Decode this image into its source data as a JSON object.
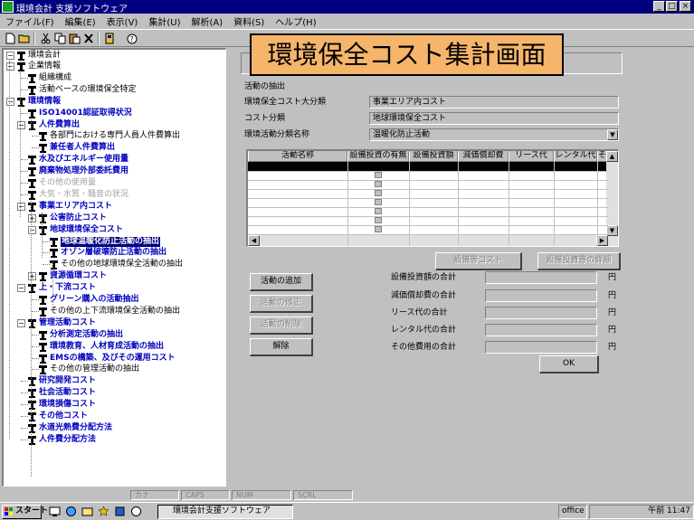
{
  "window": {
    "title": "環境会計 支援ソフトウェア",
    "minimize": "_",
    "maximize": "□",
    "close": "×"
  },
  "menu": [
    "ファイル(F)",
    "編集(E)",
    "表示(V)",
    "集計(U)",
    "解析(A)",
    "資料(S)",
    "ヘルプ(H)"
  ],
  "banner": "環境保全コスト集計画面",
  "tree": {
    "root": "環境会計",
    "items": [
      {
        "text": "企業情報",
        "style": "black"
      },
      {
        "text": "組織構成",
        "style": "black"
      },
      {
        "text": "活動ベースの環境保全特定",
        "style": "black"
      },
      {
        "text": "環境情報",
        "style": "blue"
      },
      {
        "text": "ISO14001認証取得状況",
        "style": "blue"
      },
      {
        "text": "人件費算出",
        "style": "blue"
      },
      {
        "text": "各部門における専門人員人件費算出",
        "style": "black"
      },
      {
        "text": "兼任者人件費算出",
        "style": "blue"
      },
      {
        "text": "水及びエネルギー使用量",
        "style": "blue"
      },
      {
        "text": "廃棄物処理外部委託費用",
        "style": "blue"
      },
      {
        "text": "その他の使用量",
        "style": "gray"
      },
      {
        "text": "大気・水質・騒音の状況",
        "style": "gray"
      },
      {
        "text": "事業エリア内コスト",
        "style": "blue"
      },
      {
        "text": "公害防止コスト",
        "style": "blue"
      },
      {
        "text": "地球環境保全コスト",
        "style": "blue"
      },
      {
        "text": "地球温暖化防止活動の抽出",
        "style": "sel"
      },
      {
        "text": "オゾン層破壊防止活動の抽出",
        "style": "blue"
      },
      {
        "text": "その他の地球環境保全活動の抽出",
        "style": "black"
      },
      {
        "text": "資源循環コスト",
        "style": "blue"
      },
      {
        "text": "上・下流コスト",
        "style": "blue"
      },
      {
        "text": "グリーン購入の活動抽出",
        "style": "blue"
      },
      {
        "text": "その他の上下流環境保全活動の抽出",
        "style": "black"
      },
      {
        "text": "管理活動コスト",
        "style": "blue"
      },
      {
        "text": "分析測定活動の抽出",
        "style": "blue"
      },
      {
        "text": "環境教育、人材育成活動の抽出",
        "style": "blue"
      },
      {
        "text": "EMSの構築、及びその運用コスト",
        "style": "blue"
      },
      {
        "text": "その他の管理活動の抽出",
        "style": "black"
      },
      {
        "text": "研究開発コスト",
        "style": "blue"
      },
      {
        "text": "社会活動コスト",
        "style": "blue"
      },
      {
        "text": "環境損傷コスト",
        "style": "blue"
      },
      {
        "text": "その他コスト",
        "style": "blue"
      },
      {
        "text": "水道光熱費分配方法",
        "style": "blue"
      },
      {
        "text": "人件費分配方法",
        "style": "blue"
      }
    ]
  },
  "form": {
    "section_label": "活動の抽出",
    "fields": [
      {
        "label": "環境保全コスト大分類",
        "value": "事業エリア内コスト"
      },
      {
        "label": "コスト分類",
        "value": "地球環境保全コスト"
      },
      {
        "label": "環境活動分類名称",
        "value": "温暖化防止活動"
      }
    ],
    "dropdown_arrow": "▼"
  },
  "grid": {
    "columns": [
      "活動名称",
      "設備投資の有無",
      "設備投資額",
      "減価償却費",
      "リース代",
      "レンタル代",
      "その"
    ]
  },
  "buttons": {
    "equipment_cost": "設備等コスト",
    "equipment_detail": "設備投資等の詳細",
    "add": "活動の追加",
    "edit": "活動の修正",
    "delete": "活動の削除",
    "cancel": "解除",
    "ok": "OK"
  },
  "totals": [
    {
      "label": "設備投資額の合計",
      "unit": "円"
    },
    {
      "label": "減価償却費の合計",
      "unit": "円"
    },
    {
      "label": "リース代の合計",
      "unit": "円"
    },
    {
      "label": "レンタル代の合計",
      "unit": "円"
    },
    {
      "label": "その他費用の合計",
      "unit": "円"
    }
  ],
  "statusbar": [
    "カナ",
    "CAPS",
    "NUM",
    "SCRL"
  ],
  "taskbar": {
    "start": "スタート",
    "task": "環境会計支援ソフトウェア",
    "tray_label": "office",
    "clock": "午前 11:47"
  },
  "colors": {
    "titlebar": "#000080",
    "banner": "#f5b56a",
    "tree_link": "#0000c0"
  }
}
